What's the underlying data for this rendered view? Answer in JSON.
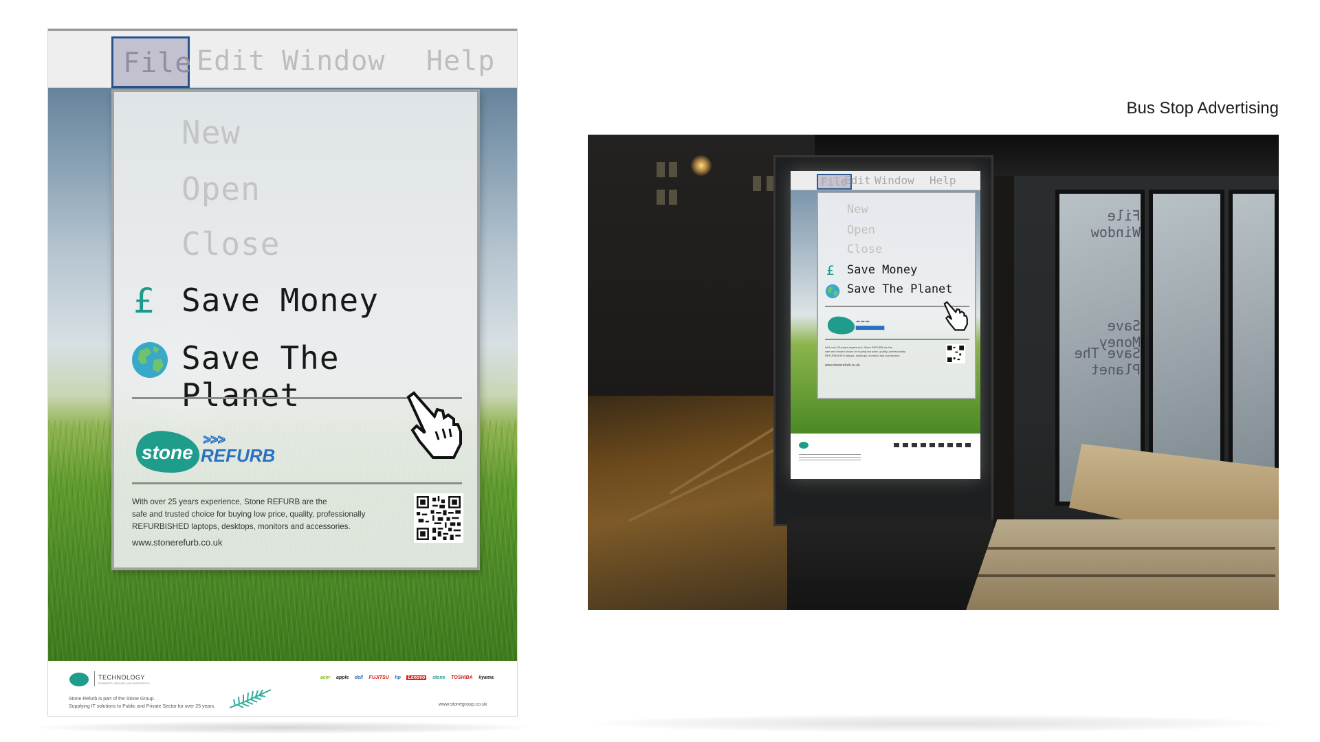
{
  "section_title": "Bus Stop Advertising",
  "poster": {
    "menubar": {
      "file": "File",
      "edit": "Edit",
      "window": "Window",
      "help": "Help"
    },
    "dropdown": {
      "new": "New",
      "open": "Open",
      "close": "Close",
      "save_money": "Save Money",
      "save_planet": "Save The Planet",
      "pound_symbol": "£"
    },
    "brand": {
      "logo_word": "stone",
      "logo_sub": "REFURB",
      "logo_arrows": ">>>",
      "color_teal": "#1f9c8c",
      "color_blue": "#2a72c0"
    },
    "body_lines": [
      "With over 25 years experience, Stone REFURB are the",
      "safe and trusted choice for buying low price, quality, professionally",
      "REFURBISHED laptops, desktops, monitors and accessories."
    ],
    "url": "www.stonerefurb.co.uk",
    "footer": {
      "tech_label": "TECHNOLOGY",
      "tagline": "POWERED, SERVED AND SUPPORTED",
      "line1": "Stone Refurb is part of the Stone Group.",
      "line2": "Supplying IT solutions to Public and Private Sector for over 25 years.",
      "url": "www.stonegroup.co.uk",
      "brands": [
        "acer",
        "apple",
        "dell",
        "FUJITSU",
        "hp",
        "Lenovo",
        "stone",
        "TOSHIBA",
        "iiyama"
      ]
    }
  },
  "photo": {
    "lightbox": {
      "file": "File",
      "edit": "Edit",
      "window": "Window",
      "help": "Help",
      "new": "New",
      "open": "Open",
      "close": "Close",
      "save_money": "Save Money",
      "save_planet": "Save The Planet",
      "pound_symbol": "£",
      "body_lines": [
        "With over 25 years experience, Stone REFURB are the",
        "safe and trusted choice for buying low price, quality, professionally",
        "REFURBISHED laptops, desktops, monitors and accessories."
      ],
      "url": "www.stonerefurb.co.uk"
    },
    "reflection": {
      "line1": "Save Money",
      "line2": "Save The Planet",
      "line3": "File Window"
    }
  }
}
